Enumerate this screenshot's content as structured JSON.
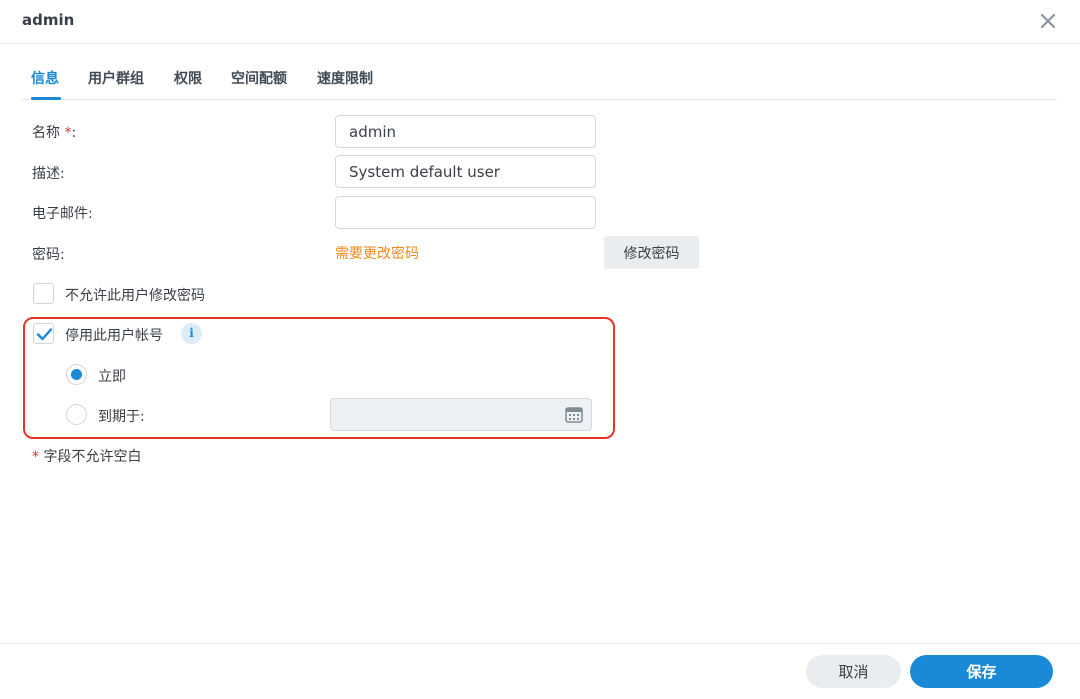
{
  "window": {
    "title": "admin",
    "close_icon": "close-icon"
  },
  "tabs": [
    {
      "label": "信息",
      "active": true
    },
    {
      "label": "用户群组",
      "active": false
    },
    {
      "label": "权限",
      "active": false
    },
    {
      "label": "空间配额",
      "active": false
    },
    {
      "label": "速度限制",
      "active": false
    }
  ],
  "form": {
    "name": {
      "label": "名称",
      "required_mark": "*",
      "colon": ":",
      "value": "admin"
    },
    "description": {
      "label": "描述:",
      "value": "System default user"
    },
    "email": {
      "label": "电子邮件:",
      "value": ""
    },
    "password": {
      "label": "密码:",
      "status_link": "需要更改密码",
      "button": "修改密码"
    },
    "disallow_change": {
      "label": "不允许此用户修改密码",
      "checked": false
    },
    "disable_account": {
      "label": "停用此用户帐号",
      "checked": true,
      "info_icon": "i",
      "options": [
        {
          "label": "立即",
          "selected": true
        },
        {
          "label": "到期于:",
          "selected": false
        }
      ],
      "date_value": "",
      "calendar_icon": "calendar-icon"
    },
    "footnote": {
      "mark": "*",
      "text": "字段不允许空白"
    }
  },
  "colors": {
    "accent": "#1a8ad8",
    "warning": "#f08a1c",
    "required": "#e0362b",
    "highlight": "#e73525"
  },
  "footer": {
    "cancel": "取消",
    "save": "保存"
  }
}
